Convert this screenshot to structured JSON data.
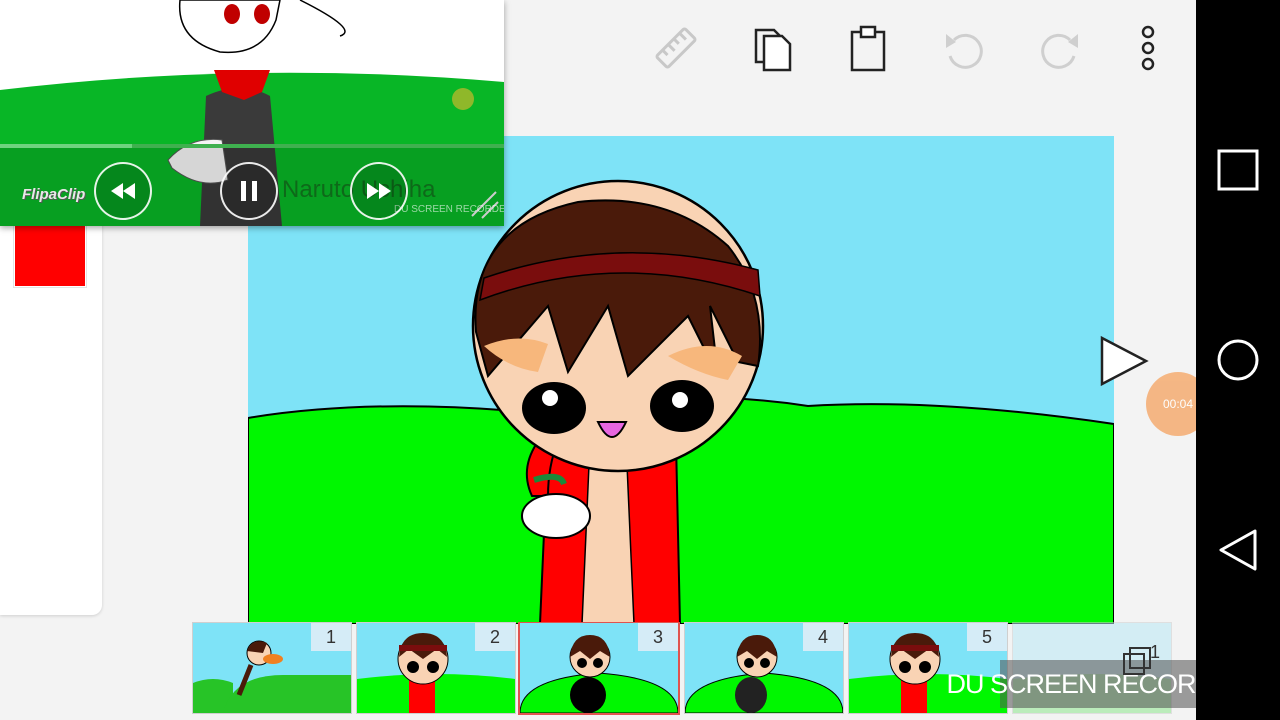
{
  "app": {
    "toolbar": {
      "items": [
        {
          "icon": "ruler-icon",
          "label": "Ruler"
        },
        {
          "icon": "copy-icon",
          "label": "Copy"
        },
        {
          "icon": "paste-icon",
          "label": "Paste"
        },
        {
          "icon": "undo-icon",
          "label": "Undo"
        },
        {
          "icon": "redo-icon",
          "label": "Redo"
        },
        {
          "icon": "more-vert-icon",
          "label": "More options"
        }
      ]
    },
    "color_swatch": "#ff0000",
    "canvas": {
      "sky_color": "#7ee3f7",
      "grass_color": "#00f700"
    },
    "playback_timer": "00:04",
    "frames": [
      {
        "number": "1",
        "selected": false
      },
      {
        "number": "2",
        "selected": false
      },
      {
        "number": "3",
        "selected": true
      },
      {
        "number": "4",
        "selected": false
      },
      {
        "number": "5",
        "selected": false
      }
    ],
    "layers_count": "1",
    "watermark": "DU SCREEN RECORDER"
  },
  "overlay_video": {
    "logo": "FlipaClip",
    "channel_name": "Naruto Uchiha",
    "recorder_label": "DU SCREEN RECORDER",
    "controls": {
      "rewind": "rewind-icon",
      "pause": "pause-icon",
      "fast_forward": "fast-forward-icon"
    }
  },
  "system_nav": {
    "recents": "recents-icon",
    "home": "home-icon",
    "back": "back-icon"
  }
}
